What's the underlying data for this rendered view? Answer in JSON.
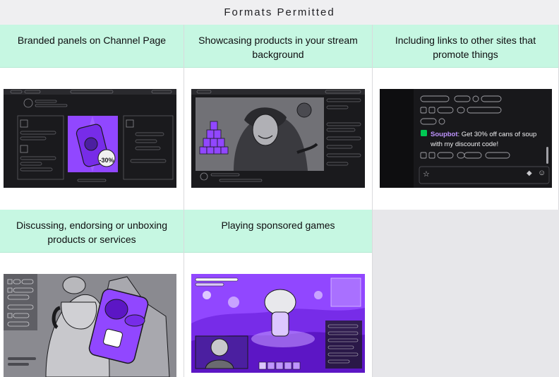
{
  "header": {
    "title": "Formats Permitted"
  },
  "cells": [
    {
      "label": "Branded panels on Channel Page",
      "badge": "-30%"
    },
    {
      "label": "Showcasing products in your stream background"
    },
    {
      "label": "Including links to other sites that promote things",
      "chat_user": "Soupbot",
      "chat_message": ": Get 30% off cans of soup",
      "chat_message_2": "with my discount code!"
    },
    {
      "label": "Discussing, endorsing or unboxing products or services"
    },
    {
      "label": "Playing sponsored games"
    },
    {
      "label": ""
    }
  ],
  "colors": {
    "accent_green_header": "#c6f7e2",
    "twitch_purple": "#9147ff",
    "dark_ui": "#18181b",
    "empty_cell": "#e7e7ea"
  },
  "icons": [
    "star-icon",
    "emote-icon",
    "bits-icon",
    "brush-icon",
    "box-icon",
    "twitch-glitch-icon"
  ]
}
